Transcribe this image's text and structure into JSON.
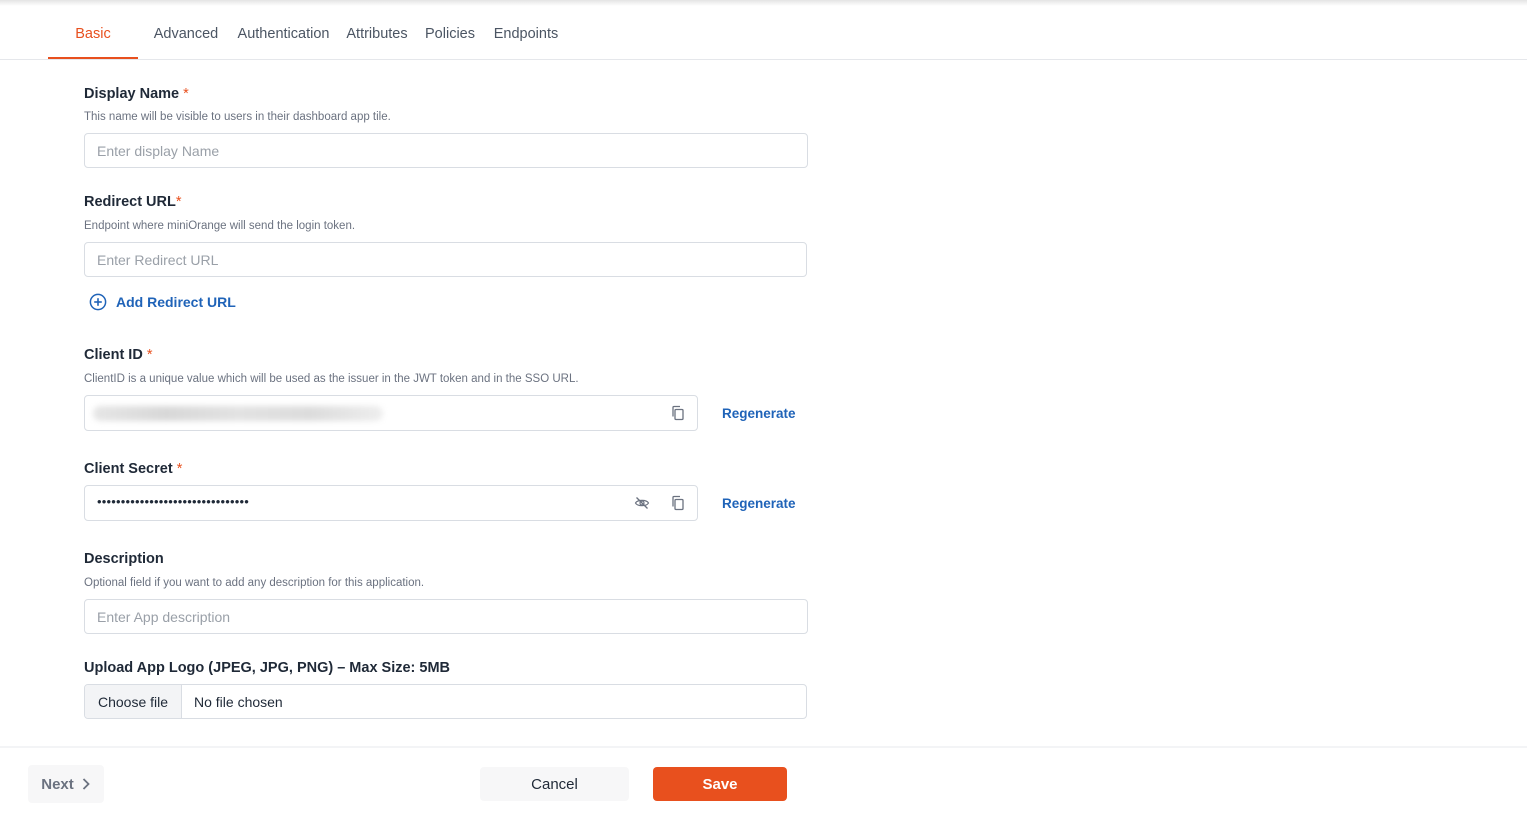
{
  "tabs": [
    {
      "label": "Basic",
      "active": true
    },
    {
      "label": "Advanced",
      "active": false
    },
    {
      "label": "Authentication",
      "active": false
    },
    {
      "label": "Attributes",
      "active": false
    },
    {
      "label": "Policies",
      "active": false
    },
    {
      "label": "Endpoints",
      "active": false
    }
  ],
  "display_name": {
    "label": "Display Name",
    "required_mark": "*",
    "help": "This name will be visible to users in their dashboard app tile.",
    "placeholder": "Enter display Name",
    "value": ""
  },
  "redirect_url": {
    "label": "Redirect URL",
    "required_mark": "*",
    "help": "Endpoint where miniOrange will send the login token.",
    "placeholder": "Enter Redirect URL",
    "value": "",
    "add_label": "Add Redirect URL",
    "add_icon": "plus-circle-icon"
  },
  "client_id": {
    "label": "Client ID",
    "required_mark": "*",
    "help": "ClientID is a unique value which will be used as the issuer in the JWT token and in the SSO URL.",
    "copy_icon": "copy-icon",
    "regenerate_label": "Regenerate"
  },
  "client_secret": {
    "label": "Client Secret",
    "required_mark": "*",
    "masked_value": "••••••••••••••••••••••••••••••••",
    "visibility_icon": "eye-off-icon",
    "copy_icon": "copy-icon",
    "regenerate_label": "Regenerate"
  },
  "description": {
    "label": "Description",
    "help": "Optional field if you want to add any description for this application.",
    "placeholder": "Enter App description",
    "value": ""
  },
  "logo_upload": {
    "label": "Upload App Logo (JPEG, JPG, PNG) – Max Size: 5MB",
    "button_label": "Choose file",
    "status": "No file chosen"
  },
  "footer": {
    "next_label": "Next",
    "next_icon": "chevron-right-icon",
    "cancel_label": "Cancel",
    "save_label": "Save"
  },
  "colors": {
    "accent": "#e8501e",
    "link": "#1f63b8"
  }
}
